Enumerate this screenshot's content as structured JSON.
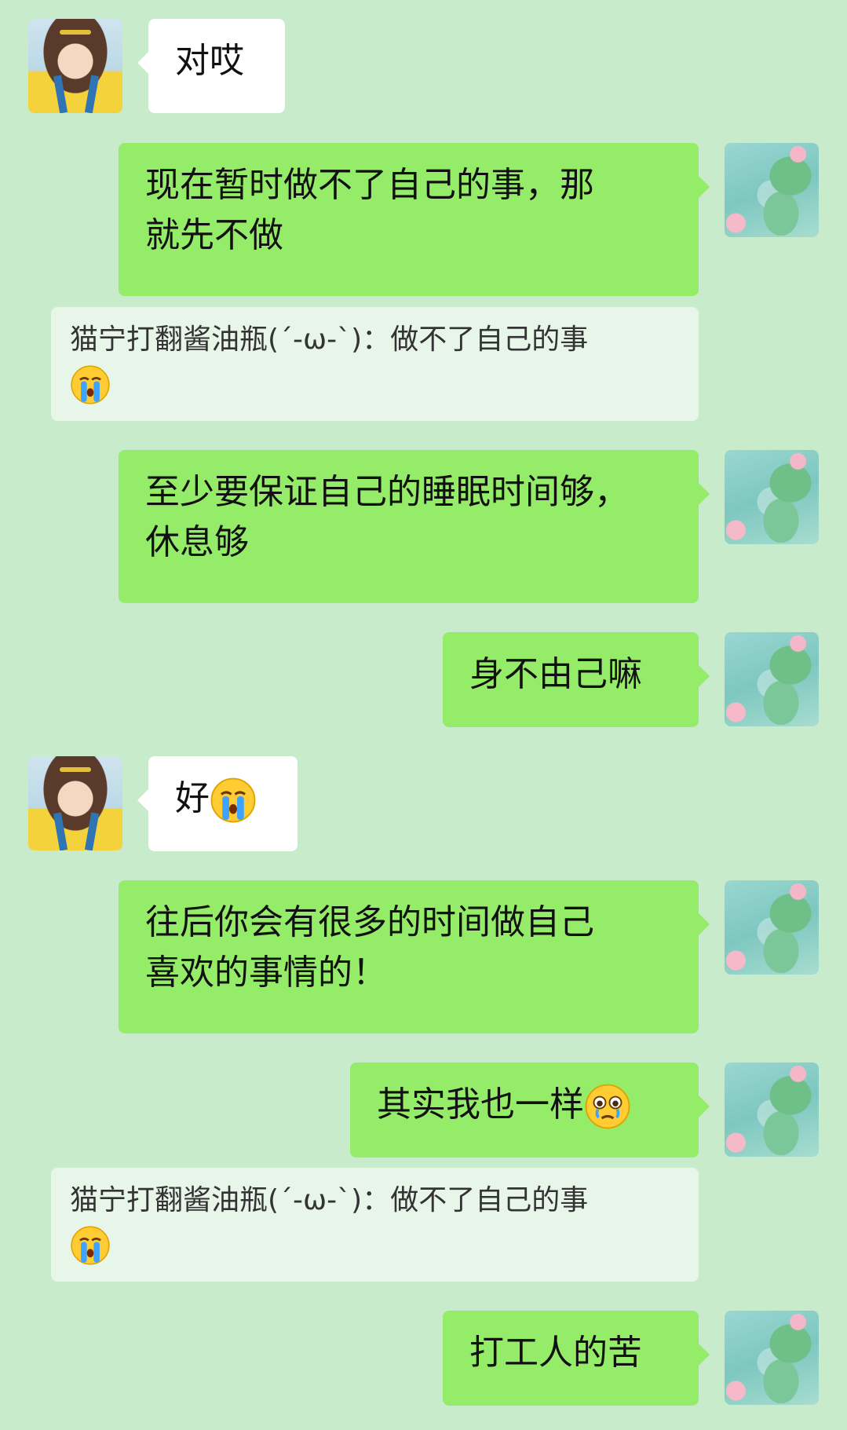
{
  "messages": [
    {
      "side": "left",
      "avatar": "girl-avatar",
      "text": "对哎"
    },
    {
      "side": "right",
      "avatar": "lotus-avatar",
      "text_lines": [
        "现在暂时做不了自己的事，那",
        "就先不做"
      ]
    },
    {
      "type": "quote",
      "text": "猫宁打翻酱油瓶(´-ω-`)：做不了自己的事",
      "emoji": "crying-emoji"
    },
    {
      "side": "right",
      "avatar": "lotus-avatar",
      "text_lines": [
        "至少要保证自己的睡眠时间够，",
        "休息够"
      ]
    },
    {
      "side": "right",
      "avatar": "lotus-avatar",
      "text": "身不由己嘛"
    },
    {
      "side": "left",
      "avatar": "girl-avatar",
      "text": "好",
      "emoji": "crying-emoji"
    },
    {
      "side": "right",
      "avatar": "lotus-avatar",
      "text_lines": [
        "往后你会有很多的时间做自己",
        "喜欢的事情的！"
      ]
    },
    {
      "side": "right",
      "avatar": "lotus-avatar",
      "text": "其实我也一样",
      "emoji": "holding-back-tears-emoji"
    },
    {
      "type": "quote",
      "text": "猫宁打翻酱油瓶(´-ω-`)：做不了自己的事",
      "emoji": "crying-emoji"
    },
    {
      "side": "right",
      "avatar": "lotus-avatar",
      "text": "打工人的苦"
    }
  ],
  "colors": {
    "background": "#c8ebcb",
    "sent_bubble": "#95ec69",
    "received_bubble": "#ffffff",
    "quote_bg": "#e8f6ea"
  }
}
